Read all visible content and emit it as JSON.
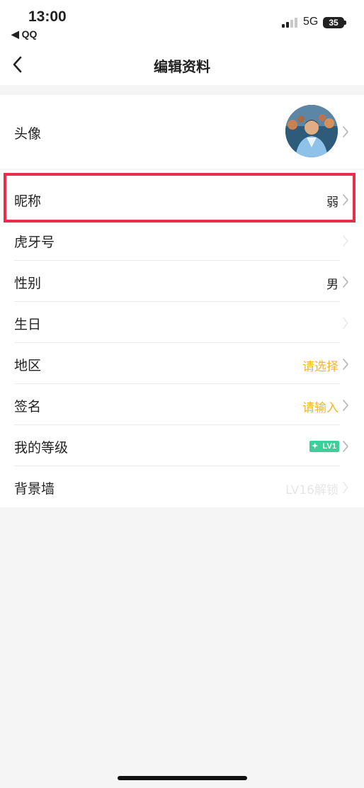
{
  "status_bar": {
    "time": "13:00",
    "back_app": "◀ QQ",
    "network": "5G",
    "battery": "35"
  },
  "nav": {
    "title": "编辑资料",
    "back_icon": "chevron-left-icon"
  },
  "profile": {
    "avatar_label": "头像",
    "rows": [
      {
        "label": "昵称",
        "value": "弱"
      },
      {
        "label": "虎牙号",
        "value": ""
      },
      {
        "label": "性别",
        "value": "男"
      },
      {
        "label": "生日",
        "value": ""
      },
      {
        "label": "地区",
        "value": "请选择"
      },
      {
        "label": "签名",
        "value": "请输入"
      },
      {
        "label": "我的等级",
        "value": "LV1"
      },
      {
        "label": "背景墙",
        "value": "LV16解锁"
      }
    ]
  },
  "colors": {
    "accent": "#f0b62e",
    "level_badge": "#3dcf9a",
    "highlight": "#ec2c4b"
  }
}
